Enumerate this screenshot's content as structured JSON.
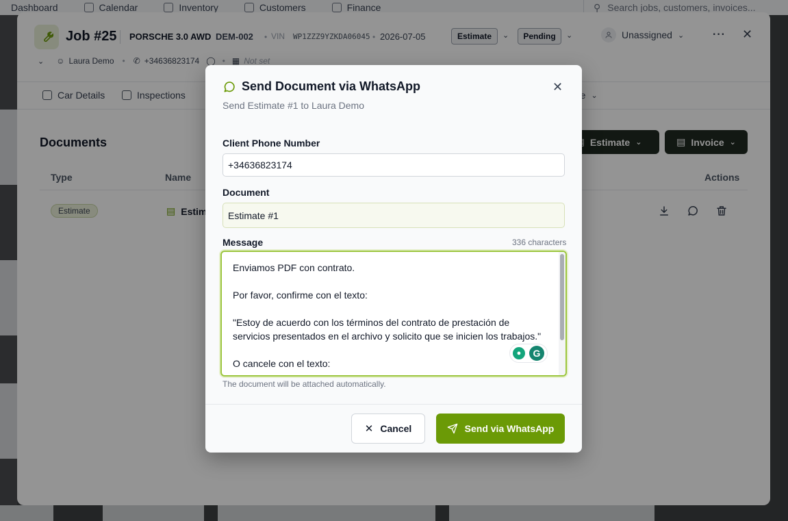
{
  "app_nav": {
    "items": [
      {
        "label": "Dashboard"
      },
      {
        "label": "Calendar"
      },
      {
        "label": "Inventory"
      },
      {
        "label": "Customers"
      },
      {
        "label": "Finance"
      }
    ],
    "search_placeholder": "Search jobs, customers, invoices..."
  },
  "job": {
    "title": "Job #25",
    "car_model": "PORSCHE 3.0 AWD",
    "plate": "DEM-002",
    "vin_label": "VIN",
    "vin": "WP1ZZZ9YZKDA06045",
    "date": "2026-07-05",
    "estimate_status": "Estimate",
    "pending_status": "Pending",
    "assignee": "Unassigned",
    "customer": "Laura Demo",
    "phone": "+34636823174",
    "due_date": "Not set"
  },
  "tabs": [
    {
      "label": "Car Details"
    },
    {
      "label": "Inspections"
    },
    {
      "label": "re"
    }
  ],
  "documents": {
    "heading": "Documents",
    "estimate_button": "Estimate",
    "invoice_button": "Invoice",
    "columns": {
      "type": "Type",
      "name": "Name",
      "actions": "Actions"
    },
    "rows": [
      {
        "type": "Estimate",
        "name": "Estim"
      }
    ]
  },
  "modal": {
    "title": "Send Document via WhatsApp",
    "subtitle": "Send Estimate #1 to Laura Demo",
    "phone_label": "Client Phone Number",
    "phone_value": "+34636823174",
    "document_label": "Document",
    "document_value": "Estimate #1",
    "message_label": "Message",
    "char_count": "336 characters",
    "message_value": "Enviamos PDF con contrato.\n\nPor favor, confirme con el texto:\n\n\"Estoy de acuerdo con los términos del contrato de prestación de servicios presentados en el archivo y solicito que se inicien los trabajos.\"\n\nO cancele con el texto:",
    "help_text": "The document will be attached automatically.",
    "cancel_label": "Cancel",
    "send_label": "Send via WhatsApp"
  },
  "colors": {
    "accent_green": "#6b9a06",
    "dark_button": "#1f2a22",
    "focus_ring": "#9bc53d"
  }
}
